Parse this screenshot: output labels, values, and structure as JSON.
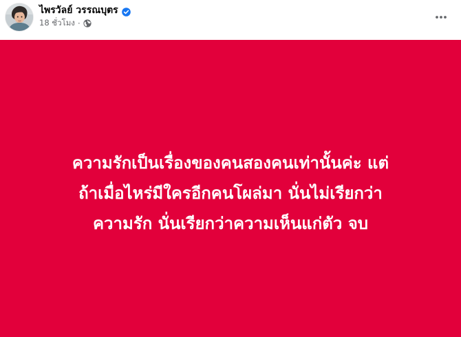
{
  "post": {
    "author": {
      "name": "ไพรวัลย์ วรรณบุตร",
      "verified": true,
      "avatar_icon": "profile-photo"
    },
    "meta": {
      "timestamp": "18 ชั่วโมง",
      "separator": "·",
      "audience_icon": "globe-icon"
    },
    "more_icon": "ellipsis-icon",
    "background_color": "#e2003b",
    "text_color": "#ffffff",
    "body_lines": [
      "ความรักเป็นเรื่องของคนสองคนเท่านั้นค่ะ แต่",
      "ถ้าเมื่อไหร่มีใครอีกคนโผล่มา นั่นไม่เรียกว่า",
      "ความรัก นั่นเรียกว่าความเห็นแก่ตัว จบ"
    ]
  }
}
